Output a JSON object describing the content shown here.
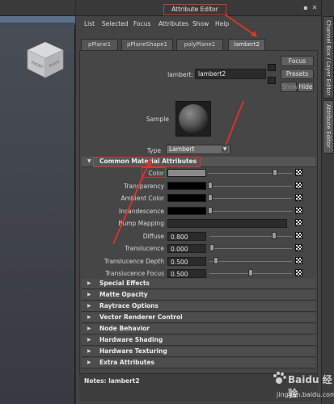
{
  "viewcube": {
    "front_label": "FRONT",
    "right_label": "RIGHT"
  },
  "attribute_editor": {
    "title": "Attribute Editor",
    "window_buttons": [
      "▪",
      "✕"
    ],
    "menu": [
      "List",
      "Selected",
      "Focus",
      "Attributes",
      "Show",
      "Help"
    ],
    "tabs": [
      "pPlane1",
      "pPlaneShape1",
      "polyPlane1",
      "lambert2"
    ],
    "active_tab": "lambert2",
    "node_label": "lambert:",
    "node_name": "lambert2",
    "buttons": {
      "focus": "Focus",
      "presets": "Presets",
      "show": "Show",
      "hide": "Hide"
    },
    "sample_label": "Sample",
    "type_label": "Type",
    "type_value": "Lambert",
    "common_section": "Common Material Attributes",
    "attributes": [
      {
        "label": "Color",
        "kind": "color",
        "color": "#8a8a8a",
        "slider": 0.8
      },
      {
        "label": "Transparency",
        "kind": "color",
        "color": "#000000",
        "slider": 0.0
      },
      {
        "label": "Ambient Color",
        "kind": "color",
        "color": "#000000",
        "slider": 0.0
      },
      {
        "label": "Incandescence",
        "kind": "color",
        "color": "#000000",
        "slider": 0.0
      },
      {
        "label": "Bump Mapping",
        "kind": "map"
      },
      {
        "label": "Diffuse",
        "kind": "number",
        "value": "0.800",
        "slider": 0.8
      },
      {
        "label": "Translucence",
        "kind": "number",
        "value": "0.000",
        "slider": 0.0
      },
      {
        "label": "Translucence Depth",
        "kind": "number",
        "value": "0.500",
        "slider": 0.05
      },
      {
        "label": "Translucence Focus",
        "kind": "number",
        "value": "0.500",
        "slider": 0.5
      }
    ],
    "collapsed_sections": [
      "Special Effects",
      "Matte Opacity",
      "Raytrace Options",
      "Vector Renderer Control",
      "Node Behavior",
      "Hardware Shading",
      "Hardware Texturing",
      "Extra Attributes"
    ],
    "notes_label": "Notes:",
    "notes_value": "lambert2"
  },
  "side_tabs": [
    "Channel Box / Layer Editor",
    "Attribute Editor"
  ],
  "watermark": {
    "text": "Baidu 经验",
    "url": "jingyan.baidu.com"
  },
  "colors": {
    "annotation_red": "#e0332a",
    "panel_bg": "#444444"
  }
}
